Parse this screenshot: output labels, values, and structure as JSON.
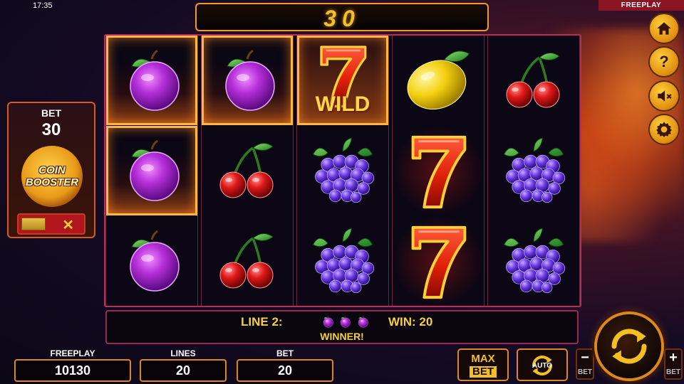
{
  "status_bar": {
    "time": "17:35",
    "mode": "FREEPLAY"
  },
  "top_display": {
    "value": "30"
  },
  "bet_panel": {
    "label": "BET",
    "value": "30",
    "booster_line1": "COIN",
    "booster_line2": "BOOSTER",
    "toggle_off_symbol": "✕"
  },
  "reels": [
    [
      "plum",
      "plum",
      "plum"
    ],
    [
      "plum",
      "cherry",
      "cherry"
    ],
    [
      "wild-seven",
      "grapes",
      "grapes"
    ],
    [
      "lemon",
      "seven",
      "seven"
    ],
    [
      "cherry",
      "grapes",
      "grapes"
    ]
  ],
  "wild_label": "WILD",
  "win_info": {
    "line_label": "LINE 2:",
    "win_label": "WIN: 20",
    "winner_label": "WINNER!"
  },
  "bottom_stats": {
    "freeplay_label": "FREEPLAY",
    "freeplay_value": "10130",
    "lines_label": "LINES",
    "lines_value": "20",
    "bet_label": "BET",
    "bet_value": "20"
  },
  "controls": {
    "max_label": "MAX",
    "max_bet_label": "BET",
    "auto_label": "AUTO",
    "minus_symbol": "−",
    "minus_label": "BET",
    "plus_symbol": "+",
    "plus_label": "BET"
  },
  "side_menu": [
    {
      "name": "home-icon"
    },
    {
      "name": "help-icon",
      "glyph": "?"
    },
    {
      "name": "sound-muted-icon"
    },
    {
      "name": "settings-icon"
    }
  ],
  "colors": {
    "accent_gold": "#f4c021",
    "frame_pink": "#b62d57",
    "frame_orange": "#d9891e",
    "freeplay_tag": "#8a1423"
  }
}
